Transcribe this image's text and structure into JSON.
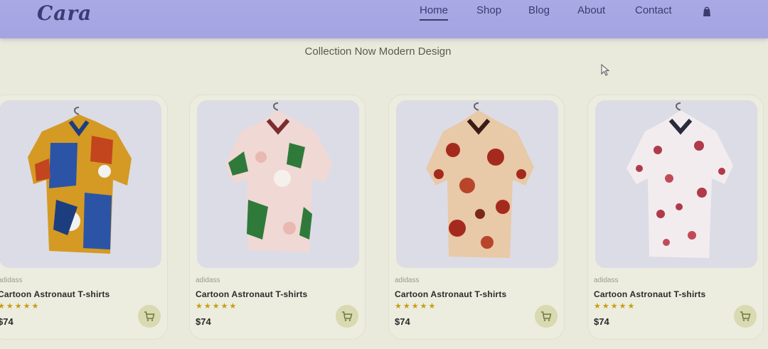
{
  "header": {
    "logo": "Cara",
    "nav": [
      {
        "label": "Home",
        "active": true
      },
      {
        "label": "Shop"
      },
      {
        "label": "Blog"
      },
      {
        "label": "About"
      },
      {
        "label": "Contact"
      }
    ],
    "bag_icon": "shopping-bag-icon"
  },
  "section": {
    "subtitle": "Collection Now Modern Design"
  },
  "products": [
    {
      "brand": "adidass",
      "name": "Cartoon Astronaut T-shirts",
      "stars": "★★★★★",
      "rating": 5,
      "price": "$74"
    },
    {
      "brand": "adidass",
      "name": "Cartoon Astronaut T-shirts",
      "stars": "★★★★★",
      "rating": 5,
      "price": "$74"
    },
    {
      "brand": "adidass",
      "name": "Cartoon Astronaut T-shirts",
      "stars": "★★★★★",
      "rating": 5,
      "price": "$74"
    },
    {
      "brand": "adidass",
      "name": "Cartoon Astronaut T-shirts",
      "stars": "★★★★★",
      "rating": 5,
      "price": "$74"
    }
  ],
  "colors": {
    "header_bg": "#a9a9e6",
    "nav_text": "#3b3b6e",
    "star": "#c89d10",
    "cart_bg": "#d9d9b2"
  }
}
